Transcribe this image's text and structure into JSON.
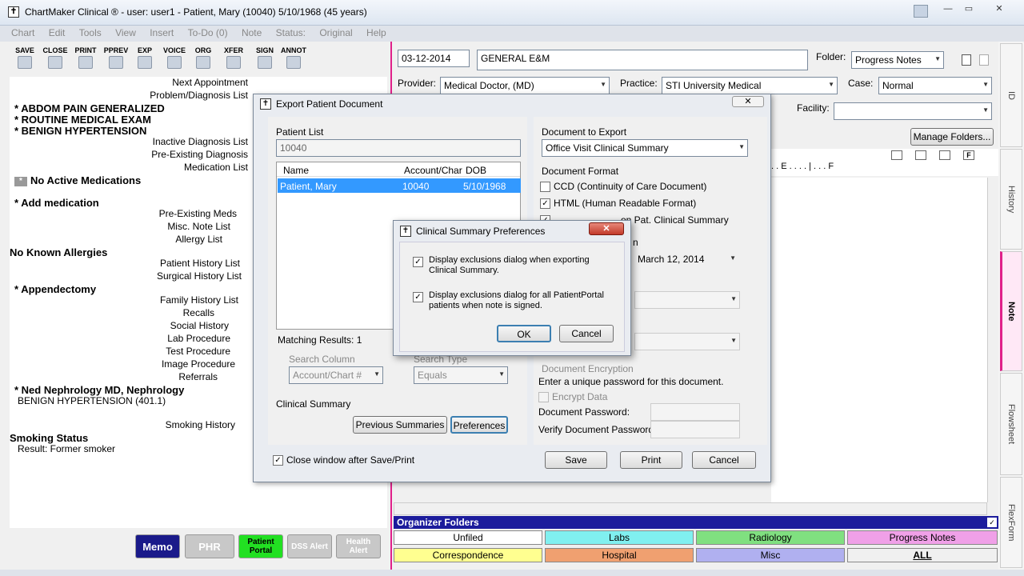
{
  "window": {
    "title": "ChartMaker Clinical ® - user: user1 - Patient, Mary (10040) 5/10/1968 (45 years)",
    "minimize": "—",
    "restore": "▭",
    "close": "✕"
  },
  "menu": [
    "Chart",
    "Edit",
    "Tools",
    "View",
    "Insert",
    "To-Do (0)",
    "Note",
    "Status:",
    "Original",
    "Help"
  ],
  "toolbar": [
    "SAVE",
    "CLOSE",
    "PRINT",
    "PPREV",
    "EXP",
    "VOICE",
    "ORG",
    "XFER",
    "SIGN",
    "ANNOT"
  ],
  "left_list": {
    "next_appointment": "Next Appointment",
    "problem_list": "Problem/Diagnosis List",
    "dx1": "*  ABDOM PAIN GENERALIZED",
    "dx2": "*  ROUTINE MEDICAL EXAM",
    "dx3": "*  BENIGN HYPERTENSION",
    "inactive_dx": "Inactive Diagnosis List",
    "preexisting_dx": "Pre-Existing Diagnosis",
    "medication_list": "Medication List",
    "no_active_meds": "No Active Medications",
    "add_medication": "*  Add medication",
    "preexisting_meds": "Pre-Existing Meds",
    "misc_note": "Misc. Note List",
    "allergy_list": "Allergy List",
    "no_allergies": "No Known Allergies",
    "patient_history": "Patient History List",
    "surgical_history": "Surgical History List",
    "appendectomy": "*  Appendectomy",
    "family_history": "Family History List",
    "recalls": "Recalls",
    "social_history": "Social History",
    "lab_procedure": "Lab Procedure",
    "test_procedure": "Test Procedure",
    "image_procedure": "Image Procedure",
    "referrals": "Referrals",
    "referral_name": "*  Ned Nephrology MD, Nephrology",
    "referral_dx": "BENIGN HYPERTENSION (401.1)",
    "smoking_history": "Smoking History",
    "smoking_status": "Smoking Status",
    "smoking_result": "Result: Former smoker"
  },
  "bottom_buttons": {
    "memo": "Memo",
    "phr": "PHR",
    "patient_portal": "Patient Portal",
    "dss_alert": "DSS Alert",
    "health_alert": "Health Alert"
  },
  "note_header": {
    "date": "03-12-2014",
    "note_type": "GENERAL E&M",
    "folder_label": "Folder:",
    "folder_value": "Progress Notes",
    "provider_label": "Provider:",
    "provider_value": "Medical Doctor, (MD)",
    "practice_label": "Practice:",
    "practice_value": "STI University Medical",
    "case_label": "Case:",
    "case_value": "Normal",
    "facility_label": "Facility:",
    "facility_value": "",
    "manage_folders": "Manage Folders...",
    "ruler": ". . E . . . . | . . . F"
  },
  "side_tabs": [
    "ID",
    "History",
    "Note",
    "Flowsheet",
    "FlexForm"
  ],
  "organizer": {
    "title": "Organizer Folders",
    "folders": [
      {
        "label": "Unfiled",
        "color": "#ffffff"
      },
      {
        "label": "Labs",
        "color": "#80f0f0"
      },
      {
        "label": "Radiology",
        "color": "#80e080"
      },
      {
        "label": "Progress Notes",
        "color": "#f0a0e8"
      },
      {
        "label": "Correspondence",
        "color": "#ffff90"
      },
      {
        "label": "Hospital",
        "color": "#f0a070"
      },
      {
        "label": "Misc",
        "color": "#b0b0f0"
      },
      {
        "label": "ALL",
        "color": "#f0f0f0"
      }
    ]
  },
  "export_dialog": {
    "title": "Export Patient Document",
    "patient_list_label": "Patient List",
    "patient_search": "10040",
    "columns": [
      "Name",
      "Account/Char",
      "DOB"
    ],
    "rows": [
      {
        "name": "Patient, Mary",
        "account": "10040",
        "dob": "5/10/1968"
      }
    ],
    "matching_results": "Matching Results: 1",
    "search_column_label": "Search Column",
    "search_column_value": "Account/Chart #",
    "search_type_label": "Search Type",
    "search_type_value": "Equals",
    "clinical_summary_label": "Clinical Summary",
    "previous_summaries": "Previous Summaries",
    "preferences": "Preferences",
    "close_after": "Close window after Save/Print",
    "doc_to_export_label": "Document to Export",
    "doc_to_export_value": "Office Visit Clinical Summary",
    "doc_format_label": "Document Format",
    "ccd": "CCD (Continuity of Care Document)",
    "html": "HTML (Human Readable Format)",
    "show_comments": "on Pat. Clinical Summary",
    "date_partial": "n",
    "date_value": "March   12, 2014",
    "encryption_label": "Document Encryption",
    "encryption_hint": "Enter a unique password for this document.",
    "encrypt_data": "Encrypt Data",
    "doc_password": "Document Password:",
    "verify_password": "Verify Document Password:",
    "save": "Save",
    "print": "Print",
    "cancel": "Cancel",
    "close_x": "✕"
  },
  "prefs_dialog": {
    "title": "Clinical Summary Preferences",
    "opt1": "Display exclusions dialog when exporting Clinical Summary.",
    "opt2": "Display exclusions dialog for all PatientPortal patients when note is signed.",
    "ok": "OK",
    "cancel": "Cancel",
    "close_x": "✕"
  }
}
